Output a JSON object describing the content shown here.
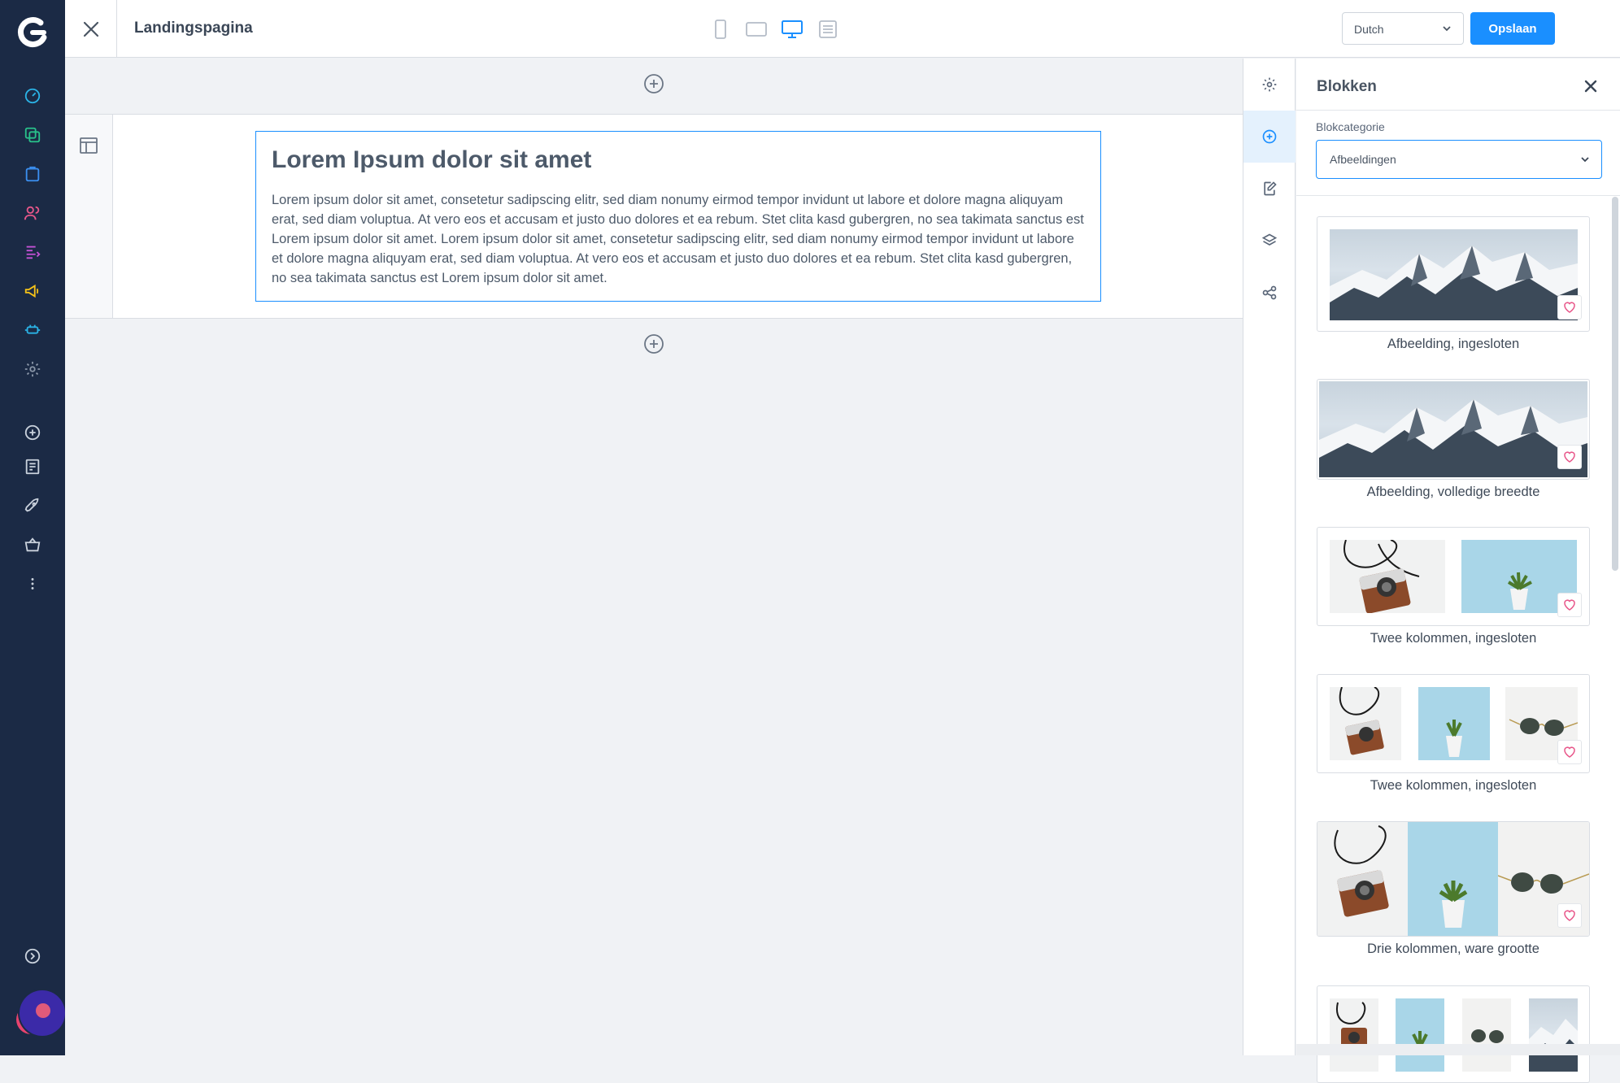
{
  "topbar": {
    "page_title": "Landingspagina",
    "language": "Dutch",
    "save_label": "Opslaan"
  },
  "canvas": {
    "heading": "Lorem Ipsum dolor sit amet",
    "body": "Lorem ipsum dolor sit amet, consetetur sadipscing elitr, sed diam nonumy eirmod tempor invidunt ut labore et dolore magna aliquyam erat, sed diam voluptua. At vero eos et accusam et justo duo dolores et ea rebum. Stet clita kasd gubergren, no sea takimata sanctus est Lorem ipsum dolor sit amet. Lorem ipsum dolor sit amet, consetetur sadipscing elitr, sed diam nonumy eirmod tempor invidunt ut labore et dolore magna aliquyam erat, sed diam voluptua. At vero eos et accusam et justo duo dolores et ea rebum. Stet clita kasd gubergren, no sea takimata sanctus est Lorem ipsum dolor sit amet."
  },
  "sidebar": {
    "title": "Blokken",
    "category_label": "Blokcategorie",
    "category_value": "Afbeeldingen",
    "blocks": [
      {
        "label": "Afbeelding, ingesloten"
      },
      {
        "label": "Afbeelding, volledige breedte"
      },
      {
        "label": "Twee kolommen, ingesloten"
      },
      {
        "label": "Twee kolommen, ingesloten"
      },
      {
        "label": "Drie kolommen, ware grootte"
      }
    ]
  },
  "colors": {
    "accent": "#1a8fff",
    "nav_bg": "#1b2a45",
    "heart": "#e8578a"
  }
}
